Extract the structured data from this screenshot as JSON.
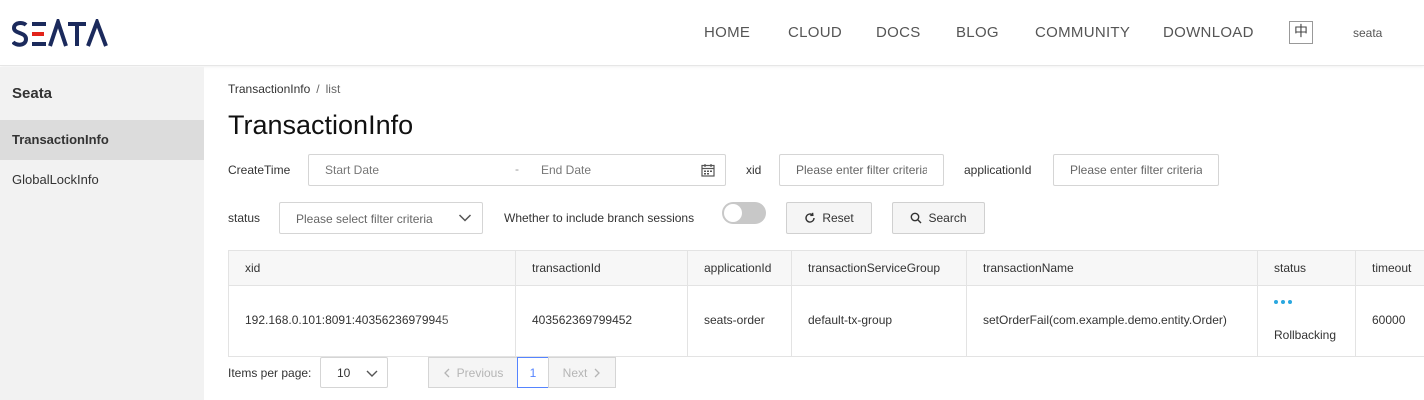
{
  "header": {
    "logo_text": "SEATA",
    "nav": [
      "HOME",
      "CLOUD",
      "DOCS",
      "BLOG",
      "COMMUNITY",
      "DOWNLOAD"
    ],
    "lang_button": "中",
    "user": "seata"
  },
  "sidebar": {
    "title": "Seata",
    "items": [
      {
        "label": "TransactionInfo",
        "active": true
      },
      {
        "label": "GlobalLockInfo",
        "active": false
      }
    ]
  },
  "breadcrumb": {
    "parent": "TransactionInfo",
    "separator": "/",
    "current": "list"
  },
  "page_title": "TransactionInfo",
  "filters": {
    "create_time_label": "CreateTime",
    "start_date_placeholder": "Start Date",
    "date_separator": "-",
    "end_date_placeholder": "End Date",
    "xid_label": "xid",
    "xid_placeholder": "Please enter filter criteria",
    "application_id_label": "applicationId",
    "application_id_placeholder": "Please enter filter criteria",
    "status_label": "status",
    "status_placeholder": "Please select filter criteria",
    "branch_sessions_label": "Whether to include branch sessions",
    "branch_sessions_enabled": false,
    "reset_label": "Reset",
    "search_label": "Search"
  },
  "table": {
    "columns": [
      "xid",
      "transactionId",
      "applicationId",
      "transactionServiceGroup",
      "transactionName",
      "status",
      "timeout"
    ],
    "rows": [
      {
        "xid": "192.168.0.101:8091:40356236979945",
        "transactionId": "403562369799452",
        "applicationId": "seats-order",
        "transactionServiceGroup": "default-tx-group",
        "transactionName": "setOrderFail(com.example.demo.entity.Order)",
        "status": "Rollbacking",
        "timeout": "60000"
      }
    ]
  },
  "pagination": {
    "items_per_page_label": "Items per page:",
    "items_per_page": "10",
    "previous_label": "Previous",
    "current_page": "1",
    "next_label": "Next"
  },
  "colors": {
    "accent_blue": "#5584ff",
    "status_dots": "#2aa7df",
    "sidebar_bg": "#f2f2f2"
  }
}
